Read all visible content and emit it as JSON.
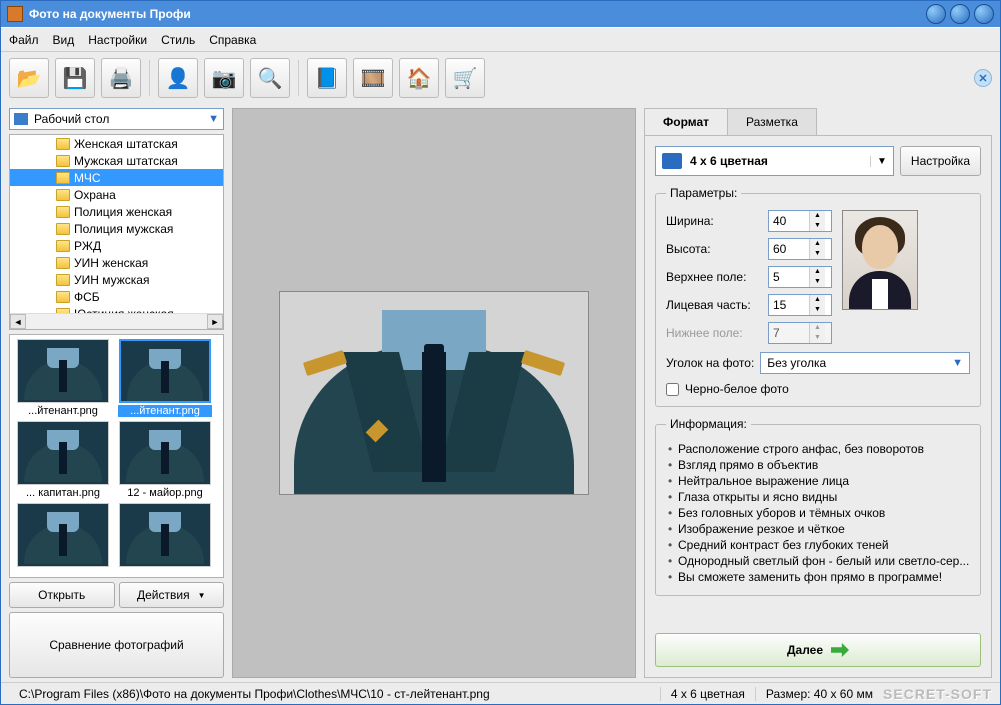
{
  "window": {
    "title": "Фото на документы Профи"
  },
  "menu": {
    "file": "Файл",
    "view": "Вид",
    "settings": "Настройки",
    "style": "Стиль",
    "help": "Справка"
  },
  "left": {
    "path": "Рабочий стол",
    "tree": [
      {
        "label": "Женская штатская"
      },
      {
        "label": "Мужская штатская"
      },
      {
        "label": "МЧС",
        "selected": true
      },
      {
        "label": "Охрана"
      },
      {
        "label": "Полиция женская"
      },
      {
        "label": "Полиция мужская"
      },
      {
        "label": "РЖД"
      },
      {
        "label": "УИН женская"
      },
      {
        "label": "УИН мужская"
      },
      {
        "label": "ФСБ"
      },
      {
        "label": "Юстиция женская"
      }
    ],
    "thumbs": [
      {
        "label": "...йтенант.png"
      },
      {
        "label": "...йтенант.png",
        "selected": true
      },
      {
        "label": "... капитан.png"
      },
      {
        "label": "12 - майор.png"
      },
      {
        "label": ""
      },
      {
        "label": ""
      }
    ],
    "open": "Открыть",
    "actions": "Действия",
    "compare": "Сравнение фотографий"
  },
  "right": {
    "tab_format": "Формат",
    "tab_layout": "Разметка",
    "format_value": "4 x 6 цветная",
    "setup": "Настройка",
    "params_legend": "Параметры:",
    "width_label": "Ширина:",
    "width_value": "40",
    "height_label": "Высота:",
    "height_value": "60",
    "top_label": "Верхнее поле:",
    "top_value": "5",
    "face_label": "Лицевая часть:",
    "face_value": "15",
    "bottom_label": "Нижнее поле:",
    "bottom_value": "7",
    "corner_label": "Уголок на фото:",
    "corner_value": "Без уголка",
    "bw_label": "Черно-белое фото",
    "info_legend": "Информация:",
    "info": [
      "Расположение строго анфас, без поворотов",
      "Взгляд прямо в объектив",
      "Нейтральное выражение лица",
      "Глаза открыты и ясно видны",
      "Без головных уборов и тёмных очков",
      "Изображение резкое и чёткое",
      "Средний контраст без глубоких теней",
      "Однородный светлый фон - белый или светло-сер...",
      "Вы сможете заменить фон прямо в программе!"
    ],
    "next": "Далее"
  },
  "status": {
    "path": "C:\\Program Files (x86)\\Фото на документы Профи\\Clothes\\МЧС\\10 - ст-лейтенант.png",
    "format": "4 x 6 цветная",
    "size": "Размер: 40 x 60 мм"
  },
  "watermark": "SECRET-SOFT"
}
